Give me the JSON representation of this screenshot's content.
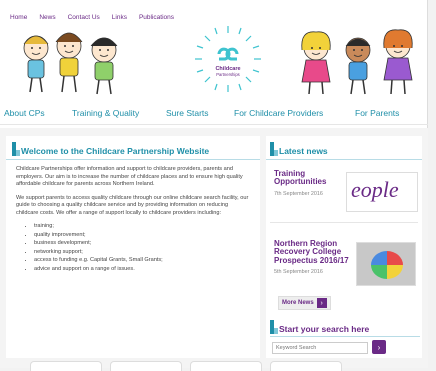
{
  "top_nav": [
    "Home",
    "News",
    "Contact Us",
    "Links",
    "Publications"
  ],
  "logo": {
    "line1": "Childcare",
    "line2": "Partnerships"
  },
  "main_nav": [
    "About CPs",
    "Training & Quality",
    "Sure Starts",
    "For Childcare Providers",
    "For Parents"
  ],
  "welcome": {
    "title": "Welcome to the Childcare Partnership Website",
    "para1": "Childcare Partnerships offer information and support to childcare providers, parents and employers. Our aim is to increase the number of childcare places and to ensure high quality affordable childcare for parents across Northern Ireland.",
    "para2": "We support parents to access quality childcare through our online childcare search facility, our guide to choosing a quality childcare service and by providing information on reducing childcare costs. We offer a range of support locally to childcare providers including:",
    "bullets": [
      "training;",
      "quality improvement;",
      "business development;",
      "networking support;",
      "access to funding e.g. Capital Grants, Small Grants;",
      "advice and support on a range of issues."
    ]
  },
  "news": {
    "title": "Latest news",
    "items": [
      {
        "title": "Training Opportunities",
        "date": "7th September 2016",
        "thumb_text": "eople"
      },
      {
        "title": "Northern Region Recovery College Prospectus 2016/17",
        "date": "5th September 2016"
      }
    ],
    "more_label": "More News"
  },
  "search": {
    "title": "Start your search here",
    "placeholder": "Keyword Search"
  },
  "colors": {
    "purple": "#6a2a86",
    "teal": "#1f8fa8"
  }
}
